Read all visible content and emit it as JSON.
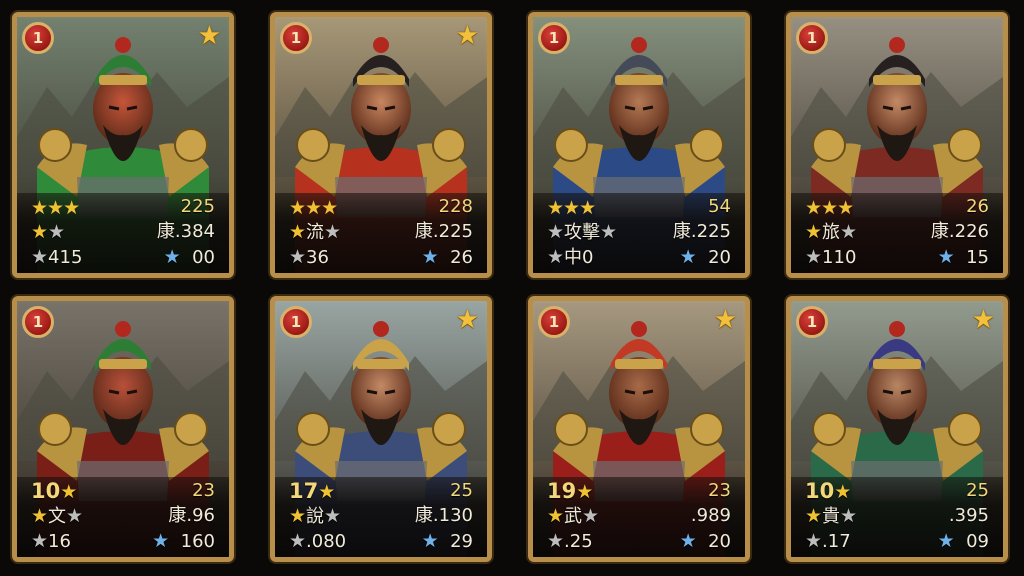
{
  "cards": [
    {
      "rank": "1",
      "stars": [
        1,
        1,
        1
      ],
      "power": "225",
      "r2_left": "",
      "r2_left_stars": [
        1,
        0,
        0
      ],
      "r2_right": "康.384",
      "r3_left": "415",
      "r3_right": "00",
      "has_top_star": true,
      "palette": {
        "robe": "#2f8a3a",
        "hat": "#2d7d35",
        "skin": "#c5553a",
        "bg": "#7a8a78"
      }
    },
    {
      "rank": "1",
      "stars": [
        1,
        1,
        1
      ],
      "power": "228",
      "r2_left": "流",
      "r2_left_stars": [
        1,
        0,
        0
      ],
      "r2_right": "康.225",
      "r3_left": "36",
      "r3_right": "26",
      "has_top_star": true,
      "palette": {
        "robe": "#b6321e",
        "hat": "#262020",
        "skin": "#c88660",
        "bg": "#b3a381"
      }
    },
    {
      "rank": "1",
      "stars": [
        1,
        1,
        1
      ],
      "power": "54",
      "r2_left": "攻擊",
      "r2_left_stars": [
        0,
        0,
        0
      ],
      "r2_right": "康.225",
      "r3_left": "中0",
      "r3_right": "20",
      "has_top_star": false,
      "palette": {
        "robe": "#2c4a86",
        "hat": "#444a58",
        "skin": "#b57a55",
        "bg": "#8c9a86"
      }
    },
    {
      "rank": "1",
      "stars": [
        1,
        1,
        1
      ],
      "power": "26",
      "r2_left": "旅",
      "r2_left_stars": [
        1,
        0,
        0
      ],
      "r2_right": "康.226",
      "r3_left": "110",
      "r3_right": "15",
      "has_top_star": false,
      "palette": {
        "robe": "#7d2a22",
        "hat": "#262020",
        "skin": "#c48a66",
        "bg": "#a09a8c"
      }
    },
    {
      "rank": "1",
      "stars": [],
      "power": "23",
      "level": "10",
      "r2_left": "文",
      "r2_left_stars": [
        1,
        0,
        0
      ],
      "r2_right": "康.96",
      "r3_left": "16",
      "r3_right": "160",
      "has_top_star": false,
      "palette": {
        "robe": "#7a1e18",
        "hat": "#2d7d35",
        "skin": "#b8503a",
        "bg": "#7f7a70"
      }
    },
    {
      "rank": "1",
      "stars": [],
      "power": "25",
      "level": "17",
      "r2_left": "說",
      "r2_left_stars": [
        1,
        0,
        0
      ],
      "r2_right": "康.130",
      "r3_left": ".080",
      "r3_right": "29",
      "has_top_star": true,
      "palette": {
        "robe": "#3d4d7a",
        "hat": "#c9a24a",
        "skin": "#c48a66",
        "bg": "#a3b2b0"
      }
    },
    {
      "rank": "1",
      "stars": [],
      "power": "23",
      "level": "19",
      "r2_left": "武",
      "r2_left_stars": [
        1,
        0,
        0
      ],
      "r2_right": ".989",
      "r3_left": ".25",
      "r3_right": "20",
      "has_top_star": true,
      "palette": {
        "robe": "#9a1f1a",
        "hat": "#c23a24",
        "skin": "#a86a48",
        "bg": "#b2a48a"
      }
    },
    {
      "rank": "1",
      "stars": [],
      "power": "25",
      "level": "10",
      "r2_left": "貴",
      "r2_left_stars": [
        1,
        0,
        0
      ],
      "r2_right": ".395",
      "r3_left": ".17",
      "r3_right": "09",
      "has_top_star": true,
      "palette": {
        "robe": "#2a6a48",
        "hat": "#3a3a82",
        "skin": "#b98664",
        "bg": "#9ca69a"
      }
    }
  ]
}
